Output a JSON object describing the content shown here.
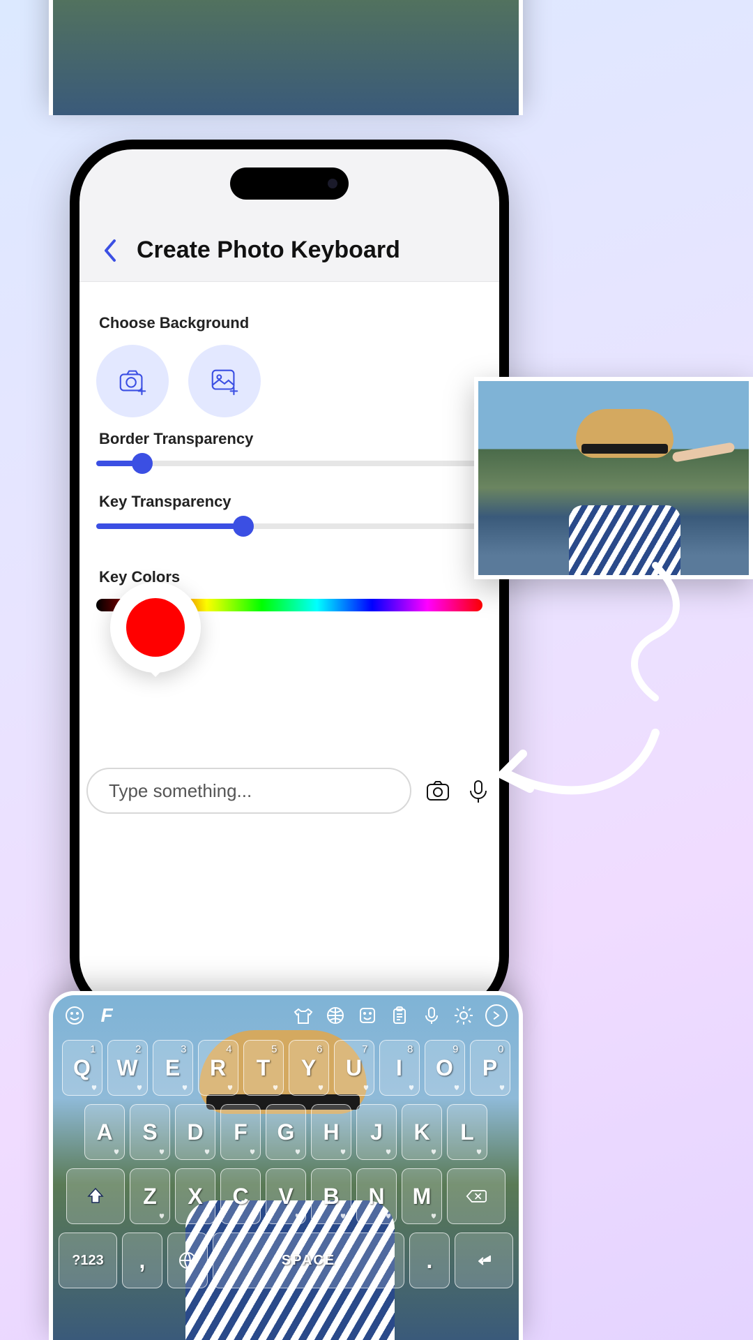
{
  "hero": {
    "word1": "Photo",
    "word2": " Keyboard"
  },
  "nav": {
    "title": "Create Photo Keyboard"
  },
  "sections": {
    "choose_bg": "Choose Background",
    "border_transparency": "Border Transparency",
    "key_transparency": "Key Transparency",
    "key_colors": "Key Colors"
  },
  "sliders": {
    "border_fill_pct": "12%",
    "key_fill_pct": "38%",
    "color_thumb_pct": "14%"
  },
  "color_preview": "#ff0000",
  "input": {
    "placeholder": "Type something..."
  },
  "keyboard": {
    "toolbar_icons": [
      "smile-icon",
      "fonts-icon",
      "shirt-icon",
      "globe-icon",
      "sticker-icon",
      "clipboard-icon",
      "mic-icon",
      "gear-icon",
      "next-icon"
    ],
    "row1": [
      {
        "k": "Q",
        "n": "1"
      },
      {
        "k": "W",
        "n": "2"
      },
      {
        "k": "E",
        "n": "3"
      },
      {
        "k": "R",
        "n": "4"
      },
      {
        "k": "T",
        "n": "5"
      },
      {
        "k": "Y",
        "n": "6"
      },
      {
        "k": "U",
        "n": "7"
      },
      {
        "k": "I",
        "n": "8"
      },
      {
        "k": "O",
        "n": "9"
      },
      {
        "k": "P",
        "n": "0"
      }
    ],
    "row2": [
      "A",
      "S",
      "D",
      "F",
      "G",
      "H",
      "J",
      "K",
      "L"
    ],
    "row3": [
      "Z",
      "X",
      "C",
      "V",
      "B",
      "N",
      "M"
    ],
    "shift": "⇧",
    "backspace": "⌫",
    "numbers_key": "?123",
    "comma_key": ",",
    "space_key": "SPACE",
    "period_key": ".",
    "enter_key": "↵"
  }
}
